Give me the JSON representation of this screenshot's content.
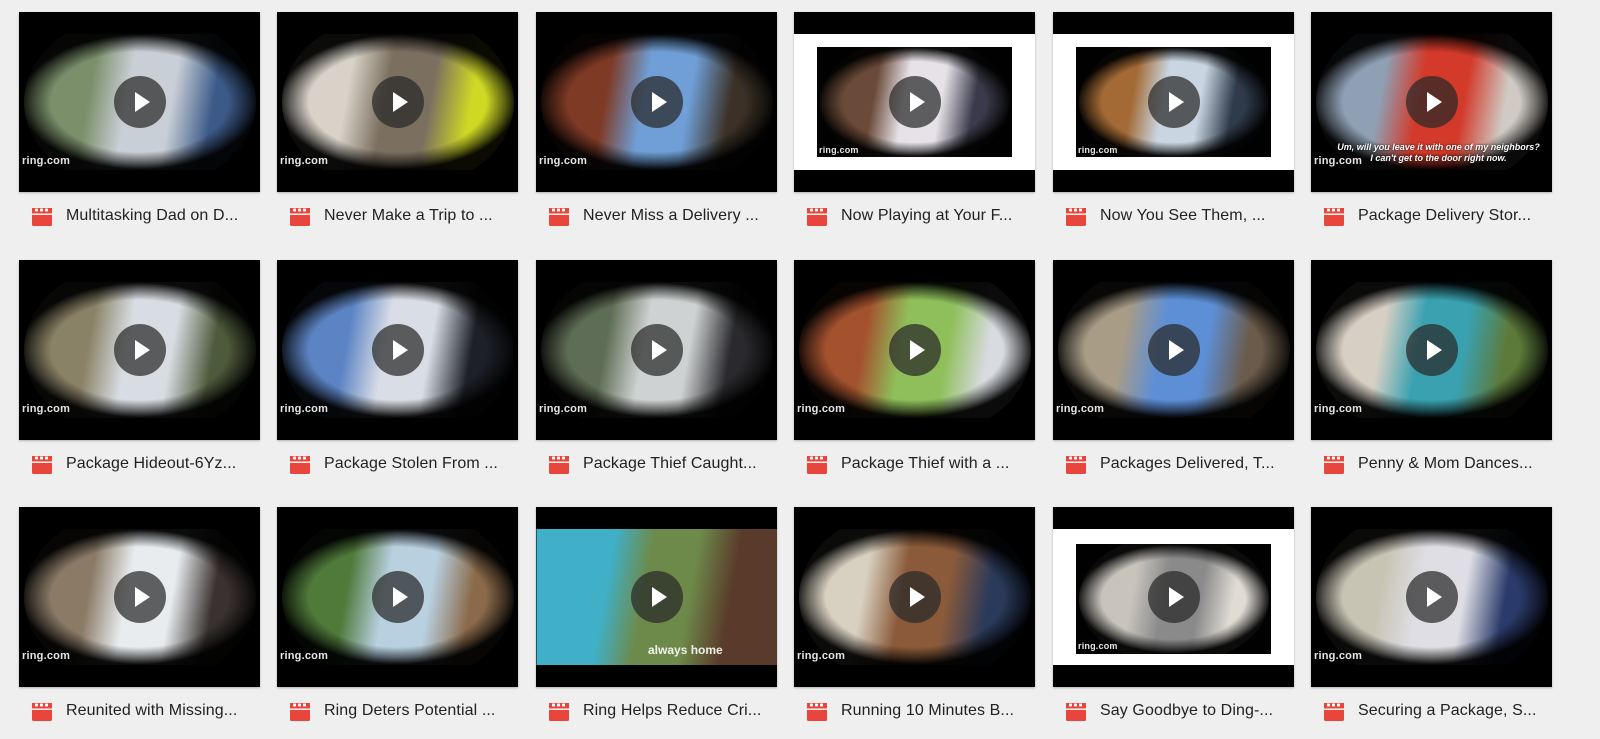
{
  "branding": {
    "watermark": "ring.com"
  },
  "colors": {
    "background": "#efefef",
    "video_icon": "#e8453c",
    "caption_text": "#222222"
  },
  "icons": {
    "file_type": "video-file-icon",
    "play": "play-icon"
  },
  "videos": [
    {
      "title": "Multitasking Dad on D...",
      "scene": [
        "#7a8f6a",
        "#c9cfd6",
        "#3c5a88"
      ]
    },
    {
      "title": "Never Make a Trip to ...",
      "scene": [
        "#d8d2c8",
        "#7b6f60",
        "#cfd924"
      ]
    },
    {
      "title": "Never Miss a Delivery ...",
      "scene": [
        "#7e3a25",
        "#6f9fd6",
        "#3c3126"
      ]
    },
    {
      "title": "Now Playing at Your F...",
      "scene": [
        "#6a4a38",
        "#e6e2e8",
        "#3a3a4a"
      ]
    },
    {
      "title": "Now You See Them, ...",
      "scene": [
        "#a36a35",
        "#c9d6e2",
        "#2f3a4a"
      ]
    },
    {
      "title": "Package Delivery Stor...",
      "scene": [
        "#8fa0b4",
        "#d33a2a",
        "#cfcac4"
      ],
      "subtitle": "Um, will you leave it with one of my neighbors?\nI can't get to the door right now."
    },
    {
      "title": "Package Hideout-6Yz...",
      "scene": [
        "#8a8266",
        "#d8dde3",
        "#4e5a3c"
      ]
    },
    {
      "title": "Package Stolen From ...",
      "scene": [
        "#5c84c4",
        "#d9dde6",
        "#1d2027"
      ]
    },
    {
      "title": "Package Thief Caught...",
      "scene": [
        "#5e6d55",
        "#cfd2d2",
        "#2a2a2e"
      ]
    },
    {
      "title": "Package Thief with a ...",
      "scene": [
        "#a4522e",
        "#8fbf5a",
        "#d8dbe0"
      ]
    },
    {
      "title": "Packages Delivered, T...",
      "scene": [
        "#a89c86",
        "#5d8fd6",
        "#6b5b4a"
      ]
    },
    {
      "title": "Penny & Mom Dances...",
      "scene": [
        "#d6cfc4",
        "#3aa1b0",
        "#5d7a3a"
      ]
    },
    {
      "title": "Reunited with Missing...",
      "scene": [
        "#8a7a66",
        "#e8ecef",
        "#3a3230"
      ]
    },
    {
      "title": "Ring Deters Potential ...",
      "scene": [
        "#4f7a3a",
        "#b8d0e0",
        "#8a6a4a"
      ]
    },
    {
      "title": "Ring Helps Reduce Cri...",
      "scene": [
        "#3fb0c8",
        "#6d8a4a",
        "#5a3a2a"
      ],
      "overlay": "always home"
    },
    {
      "title": "Running 10 Minutes B...",
      "scene": [
        "#d8d0c0",
        "#8a5a3a",
        "#2a3a5a"
      ]
    },
    {
      "title": "Say Goodbye to Ding-...",
      "scene": [
        "#c8c4bc",
        "#8a8a8a",
        "#e0dcd4"
      ]
    },
    {
      "title": "Securing a Package, S...",
      "scene": [
        "#c8c4b4",
        "#dedee4",
        "#2a3a6a"
      ]
    }
  ]
}
